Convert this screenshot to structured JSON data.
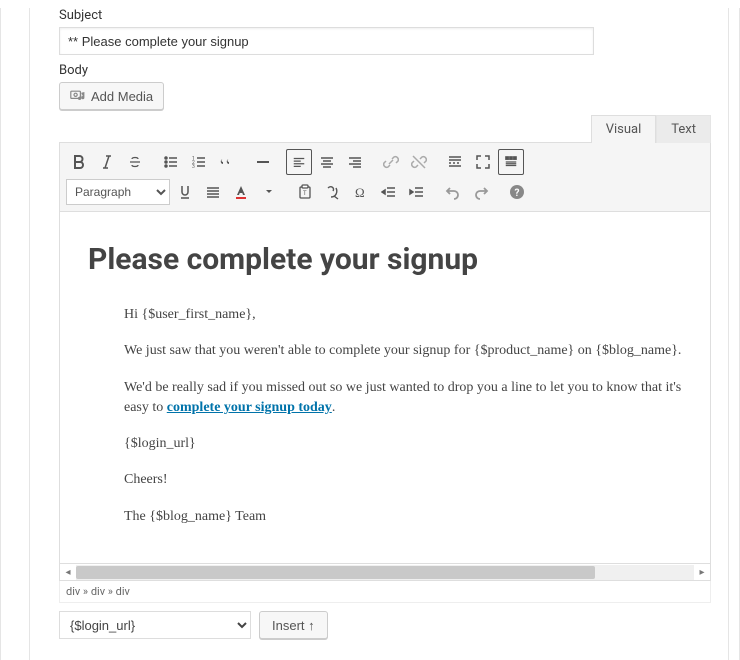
{
  "labels": {
    "subject": "Subject",
    "body": "Body"
  },
  "subject_value": "** Please complete your signup",
  "media_btn": "Add Media",
  "tabs": {
    "visual": "Visual",
    "text": "Text"
  },
  "format_dropdown": "Paragraph",
  "content": {
    "heading": "Please complete your signup",
    "p1": "Hi {$user_first_name},",
    "p2a": "We just saw that you weren't able to complete your signup for {$product_name} on {$blog_name}.",
    "p3a": "We'd be really sad if you missed out so we just wanted to drop you a line to let you to know that it's easy to ",
    "p3link": "complete your signup today",
    "p3b": ".",
    "p4": "{$login_url}",
    "p5": "Cheers!",
    "p6": "The {$blog_name} Team"
  },
  "breadcrumb": "div » div » div",
  "variable_select": "{$login_url}",
  "insert_btn": "Insert ↑"
}
